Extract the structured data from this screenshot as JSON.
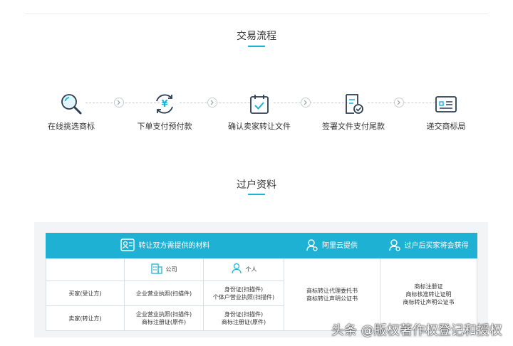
{
  "flow_section": {
    "title": "交易流程"
  },
  "steps": [
    {
      "label": "在线挑选商标",
      "icon": "search-icon"
    },
    {
      "label": "下单支付预付款",
      "icon": "yen-refresh-icon"
    },
    {
      "label": "确认卖家转让文件",
      "icon": "calendar-check-icon"
    },
    {
      "label": "签署文件支付尾款",
      "icon": "document-check-icon"
    },
    {
      "label": "递交商标局",
      "icon": "card-icon"
    }
  ],
  "docs_section": {
    "title": "过户资料"
  },
  "table": {
    "header_materials": "转让双方需提供的材料",
    "header_aliyun": "阿里云提供",
    "header_buyer_gets": "过户后买家将会获得",
    "col_company": "公司",
    "col_individual": "个人",
    "rows": [
      {
        "party": "买家(受让方)",
        "company": "企业营业执照(扫描件)",
        "individual_1": "身份证(扫描件)",
        "individual_2": "个体户营业执照(扫描件)"
      },
      {
        "party": "卖家(转让方)",
        "company_1": "企业营业执照(扫描件)",
        "company_2": "商标注册证(原件)",
        "individual_1": "身份证(扫描件)",
        "individual_2": "商标注册证(原件)"
      }
    ],
    "aliyun_items": [
      "商标转让代理委托书",
      "商标转让声明公证书"
    ],
    "buyer_gets_items": [
      "商标注册证",
      "商标核准转让证明",
      "商标转让声明公证书"
    ]
  },
  "watermark": {
    "text": "头条 @版权著作权登记和授权"
  },
  "colors": {
    "accent": "#1fb1d4",
    "icon_teal": "#19b4d6"
  }
}
